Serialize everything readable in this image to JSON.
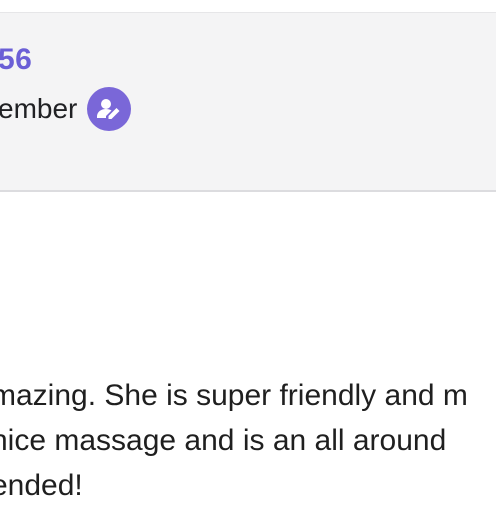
{
  "header": {
    "username_fragment": "56",
    "member_label": "ember",
    "member_icon": "user-edit-icon",
    "accent_color": "#7a67d8"
  },
  "review": {
    "lines": [
      "mazing. She is super friendly and m",
      " nice massage and is an all around",
      "ended!"
    ]
  }
}
